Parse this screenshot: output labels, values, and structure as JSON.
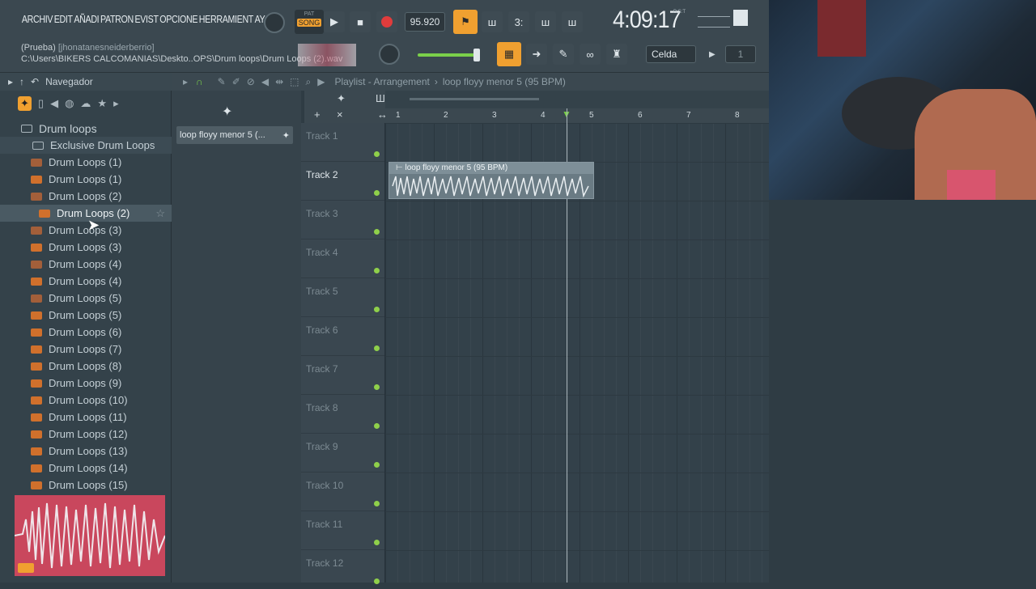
{
  "menu": [
    "ARCHIV",
    "EDIT",
    "AÑADI",
    "PATRON",
    "EVIST",
    "OPCIONE",
    "HERRAMIENT",
    "AY"
  ],
  "transport": {
    "mode": "SONG",
    "pat_label": "PAT",
    "tempo": "95.920",
    "time": "4:09:17",
    "time_unit": "B:S:T"
  },
  "hint": {
    "line1": "(Prueba)",
    "line1_sub": "[jhonatanesneiderberrio]",
    "line2": "C:\\Users\\BIKERS CALCOMANIAS\\Deskto..OPS\\Drum loops\\Drum Loops (2).wav"
  },
  "snap": {
    "label": "Celda",
    "step": "1"
  },
  "browser": {
    "title": "Navegador",
    "root": "Drum loops",
    "subfolder": "Exclusive Drum Loops",
    "items": [
      {
        "label": "Drum Loops (1)",
        "type": "mp3"
      },
      {
        "label": "Drum Loops (1)",
        "type": "wav"
      },
      {
        "label": "Drum Loops (2)",
        "type": "mp3"
      },
      {
        "label": "Drum Loops (2)",
        "type": "wav"
      },
      {
        "label": "Drum Loops (3)",
        "type": "mp3"
      },
      {
        "label": "Drum Loops (3)",
        "type": "wav"
      },
      {
        "label": "Drum Loops (4)",
        "type": "mp3"
      },
      {
        "label": "Drum Loops (4)",
        "type": "wav"
      },
      {
        "label": "Drum Loops (5)",
        "type": "mp3"
      },
      {
        "label": "Drum Loops (5)",
        "type": "wav"
      },
      {
        "label": "Drum Loops (6)",
        "type": "wav"
      },
      {
        "label": "Drum Loops (7)",
        "type": "wav"
      },
      {
        "label": "Drum Loops (8)",
        "type": "wav"
      },
      {
        "label": "Drum Loops (9)",
        "type": "wav"
      },
      {
        "label": "Drum Loops (10)",
        "type": "wav"
      },
      {
        "label": "Drum Loops (11)",
        "type": "wav"
      },
      {
        "label": "Drum Loops (12)",
        "type": "wav"
      },
      {
        "label": "Drum Loops (13)",
        "type": "wav"
      },
      {
        "label": "Drum Loops (14)",
        "type": "wav"
      },
      {
        "label": "Drum Loops (15)",
        "type": "wav"
      }
    ]
  },
  "playlist": {
    "title": "Playlist - Arrangement",
    "pattern": "loop floyy menor 5 (95 BPM)",
    "picker_item": "loop floyy menor 5 (...",
    "ruler": [
      "1",
      "2",
      "3",
      "4",
      "5",
      "6",
      "7",
      "8"
    ],
    "tracks": [
      "Track 1",
      "Track 2",
      "Track 3",
      "Track 4",
      "Track 5",
      "Track 6",
      "Track 7",
      "Track 8",
      "Track 9",
      "Track 10",
      "Track 11",
      "Track 12"
    ],
    "clip_title": "loop floyy menor 5 (95 BPM)"
  },
  "colors": {
    "accent": "#f0a030",
    "green": "#8fd04a",
    "record": "#e03c3c"
  }
}
